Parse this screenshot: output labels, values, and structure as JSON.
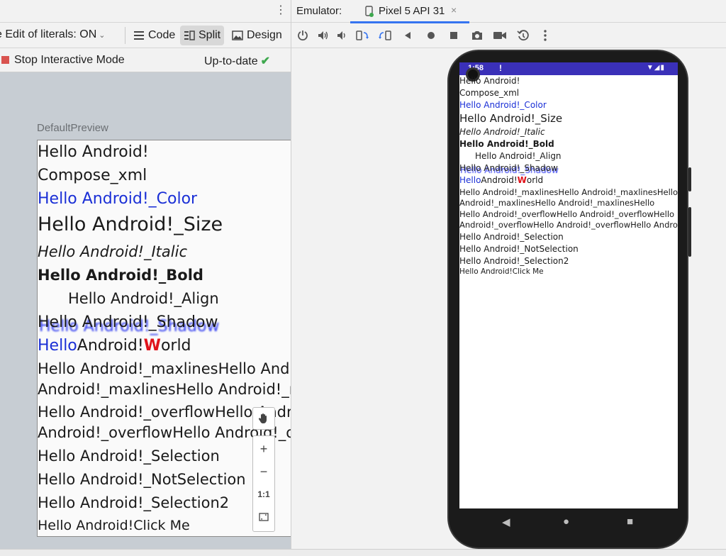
{
  "left_header": {
    "kebab": "⋮"
  },
  "toolbar": {
    "literals_label": "e Edit of literals: ON",
    "literals_chevron": "⌄",
    "code_label": "Code",
    "split_label": "Split",
    "design_label": "Design"
  },
  "interactive": {
    "stop_label": "Stop Interactive Mode",
    "status_label": "Up-to-date",
    "status_check": "✔"
  },
  "preview": {
    "label": "DefaultPreview",
    "lines": {
      "l1": "Hello Android!",
      "l2": "Compose_xml",
      "l3": "Hello Android!_Color",
      "l4": "Hello Android!_Size",
      "l5": "Hello Android!_Italic",
      "l6": "Hello Android!_Bold",
      "l7": "Hello Android!_Align",
      "l8": "Hello Android!_Shadow",
      "l9_blue": "Hello",
      "l9_mid": "Android!",
      "l9_red": "W",
      "l9_end": "orld",
      "l10a": "Hello Android!_maxlinesHello Android!_maxlinesHello",
      "l10b": "Android!_maxlinesHello Android!_maxlinesHello",
      "l11a": "Hello Android!_overflowHello Android!_overflowHello",
      "l11b": "Android!_overflowHello Android!_overflowHello Andro…",
      "l12": "Hello Android!_Selection",
      "l13": "Hello Android!_NotSelection",
      "l14": "Hello Android!_Selection2",
      "l15": "Hello Android!Click Me"
    }
  },
  "zoom": {
    "plus": "+",
    "minus": "−",
    "one_to_one": "1:1"
  },
  "emulator": {
    "label": "Emulator:",
    "tab_title": "Pixel 5 API 31",
    "tab_close": "×"
  },
  "phone_status": {
    "time": "1:58",
    "alert": "!",
    "right": "▼◢▮"
  },
  "screen": {
    "lines": {
      "s1": "Hello Android!",
      "s2": "Compose_xml",
      "s3": "Hello Android!_Color",
      "s4": "Hello Android!_Size",
      "s5": "Hello Android!_Italic",
      "s6": "Hello Android!_Bold",
      "s7": "Hello Android!_Align",
      "s8": "Hello Android!_Shadow",
      "s9_blue": "Hello",
      "s9_mid": "Android!",
      "s9_red": "W",
      "s9_end": "orld",
      "s10a": "Hello Android!_maxlinesHello Android!_maxlinesHello",
      "s10b": "Android!_maxlinesHello Android!_maxlinesHello",
      "s11a": "Hello Android!_overflowHello Android!_overflowHello",
      "s11b": "Android!_overflowHello Android!_overflowHello Andro…",
      "s12": "Hello Android!_Selection",
      "s13": "Hello Android!_NotSelection",
      "s14": "Hello Android!_Selection2",
      "s15": "Hello Android!Click Me"
    }
  },
  "nav": {
    "back": "◀",
    "home": "●",
    "recents": "■"
  },
  "colors": {
    "accent": "#3574f0",
    "compose_blue": "#1a2fd6",
    "compose_red": "#e0131b",
    "status_bar": "#3a30b8",
    "stop": "#d9534f",
    "ok": "#3ea84e"
  }
}
